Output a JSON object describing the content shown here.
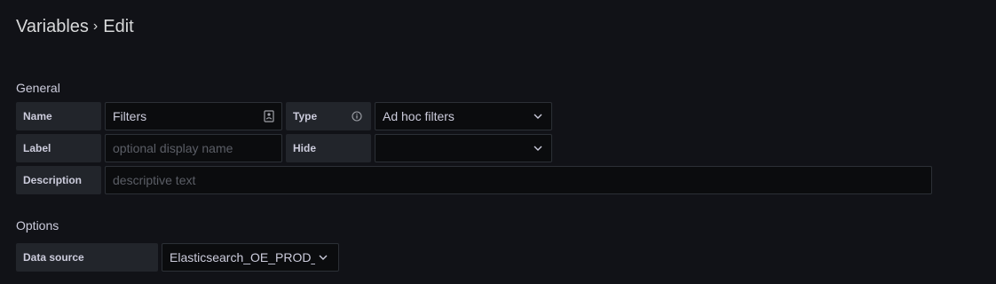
{
  "breadcrumb": {
    "parent": "Variables",
    "separator": "›",
    "current": "Edit"
  },
  "general": {
    "title": "General",
    "name": {
      "label": "Name",
      "value": "Filters"
    },
    "type": {
      "label": "Type",
      "value": "Ad hoc filters",
      "info_icon": "info-circle-icon"
    },
    "label": {
      "label": "Label",
      "placeholder": "optional display name"
    },
    "hide": {
      "label": "Hide",
      "value": ""
    },
    "description": {
      "label": "Description",
      "placeholder": "descriptive text"
    }
  },
  "options": {
    "title": "Options",
    "data_source": {
      "label": "Data source",
      "value": "Elasticsearch_OE_PROD_c"
    }
  }
}
